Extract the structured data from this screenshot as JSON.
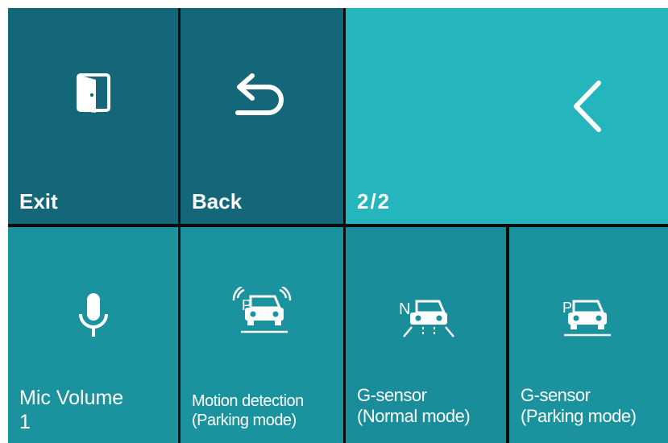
{
  "top_row": {
    "exit": {
      "label": "Exit",
      "icon": "exit-door-icon",
      "color": "#136779"
    },
    "back": {
      "label": "Back",
      "icon": "back-arrow-icon",
      "color": "#136779"
    },
    "page": {
      "indicator": "2/2",
      "icon": "chevron-left-icon",
      "color": "#25b5bc"
    }
  },
  "settings": [
    {
      "line1": "Mic Volume",
      "line2": "1",
      "icon": "microphone-icon",
      "color": "#1b939f"
    },
    {
      "line1": "Motion detection",
      "line2": "(Parking mode)",
      "icon": "motion-detection-parking-icon",
      "color": "#1b939f"
    },
    {
      "line1": "G-sensor",
      "line2": "(Normal mode)",
      "icon": "g-sensor-normal-icon",
      "color": "#1a8d9a"
    },
    {
      "line1": "G-sensor",
      "line2": "(Parking mode)",
      "icon": "g-sensor-parking-icon",
      "color": "#1b939f"
    }
  ]
}
